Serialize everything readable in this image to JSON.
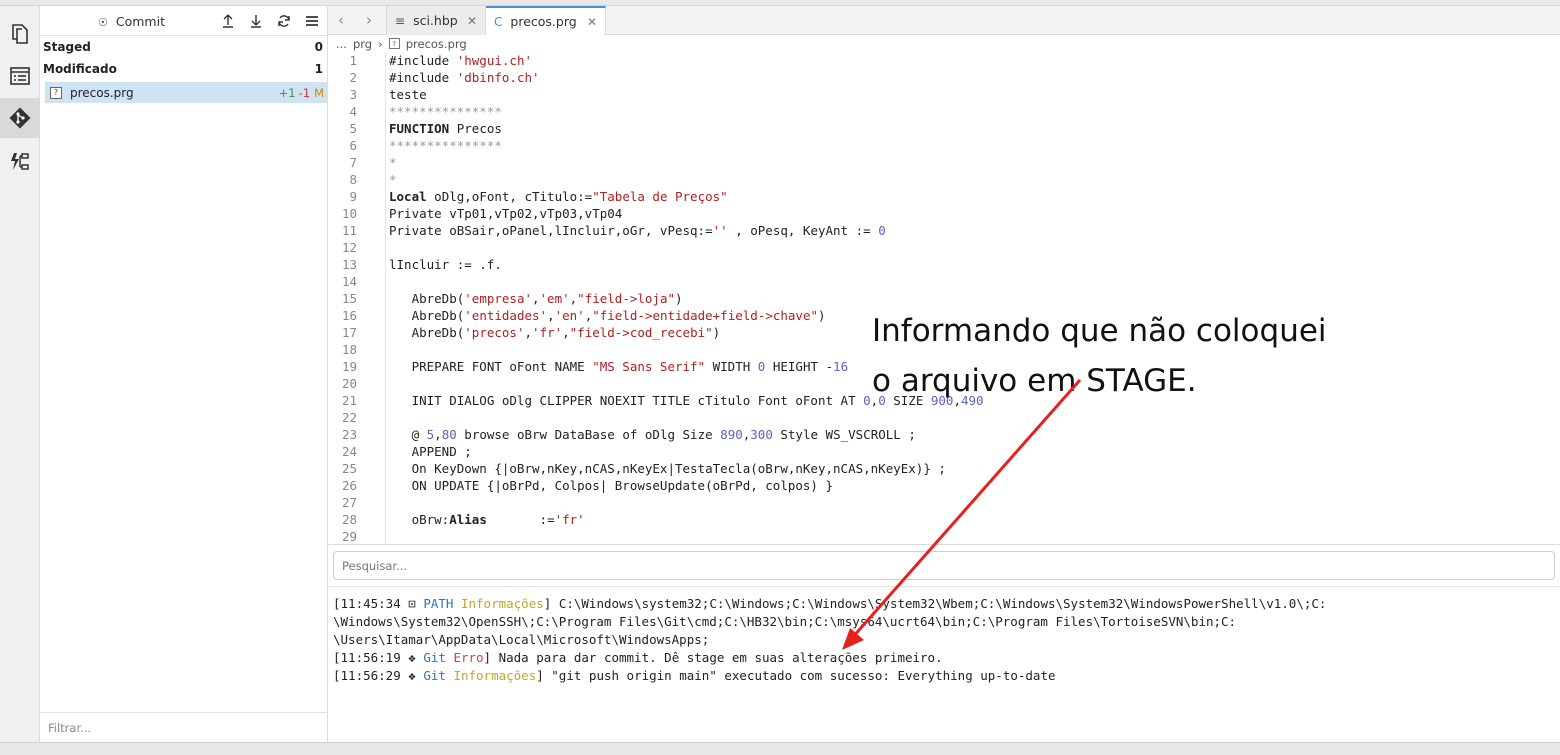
{
  "scm": {
    "title": "Commit",
    "groups": [
      {
        "label": "Staged",
        "count": "0"
      },
      {
        "label": "Modificado",
        "count": "1"
      }
    ],
    "file": {
      "name": "precos.prg",
      "added": "+1",
      "removed": "-1",
      "status": "M"
    },
    "filter_placeholder": "Filtrar..."
  },
  "tabs": [
    {
      "label": "sci.hbp"
    },
    {
      "label": "precos.prg"
    }
  ],
  "breadcrumb": {
    "ellipsis": "...",
    "folder": "prg",
    "file": "precos.prg"
  },
  "code_lines": [
    "#include 'hwgui.ch'",
    "#include 'dbinfo.ch'",
    "teste",
    "***************",
    "FUNCTION Precos",
    "***************",
    "*",
    "*",
    "Local oDlg,oFont, cTitulo:=\"Tabela de Preços\"",
    "Private vTp01,vTp02,vTp03,vTp04",
    "Private oBSair,oPanel,lIncluir,oGr, vPesq:='' , oPesq, KeyAnt := 0",
    "",
    "lIncluir := .f.",
    "",
    "   AbreDb('empresa','em',\"field->loja\")",
    "   AbreDb('entidades','en',\"field->entidade+field->chave\")",
    "   AbreDb('precos','fr',\"field->cod_recebi\")",
    "",
    "   PREPARE FONT oFont NAME \"MS Sans Serif\" WIDTH 0 HEIGHT -16",
    "",
    "   INIT DIALOG oDlg CLIPPER NOEXIT TITLE cTitulo Font oFont AT 0,0 SIZE 900,490",
    "",
    "   @ 5,80 browse oBrw DataBase of oDlg Size 890,300 Style WS_VSCROLL ;",
    "   APPEND ;",
    "   On KeyDown {|oBrw,nKey,nCAS,nKeyEx|TestaTecla(oBrw,nKey,nCAS,nKeyEx)} ;",
    "   ON UPDATE {|oBrPd, Colpos| BrowseUpdate(oBrPd, colpos) }",
    "",
    "   oBrw:Alias       :='fr'",
    ""
  ],
  "search_placeholder": "Pesquisar...",
  "output": {
    "line1": {
      "time": "[11:45:34",
      "src": "PATH",
      "tag": "Informações",
      "text": "] C:\\Windows\\system32;C:\\Windows;C:\\Windows\\System32\\Wbem;C:\\Windows\\System32\\WindowsPowerShell\\v1.0\\;C:"
    },
    "line1b": "\\Windows\\System32\\OpenSSH\\;C:\\Program Files\\Git\\cmd;C:\\HB32\\bin;C:\\msys64\\ucrt64\\bin;C:\\Program Files\\TortoiseSVN\\bin;C:",
    "line1c": "\\Users\\Itamar\\AppData\\Local\\Microsoft\\WindowsApps;",
    "line2": {
      "time": "[11:56:19",
      "src": "Git",
      "tag": "Erro",
      "text": "] Nada para dar commit. Dê stage em suas alterações primeiro."
    },
    "line3": {
      "time": "[11:56:29",
      "src": "Git",
      "tag": "Informações",
      "text": "] \"git push origin main\" executado com sucesso: Everything up-to-date"
    }
  },
  "annotation": "Informando que não coloquei\no arquivo em STAGE.",
  "colors": {
    "accent": "#4a90d9",
    "selection": "#cfe3f5",
    "arrow": "#e8201c",
    "string": "#b02020",
    "number": "#5a63c8"
  },
  "icons": {
    "activity": [
      "files-icon",
      "outline-icon",
      "git-icon",
      "flow-icon"
    ],
    "tools": [
      "push-icon",
      "pull-icon",
      "sync-icon",
      "menu-icon"
    ]
  }
}
